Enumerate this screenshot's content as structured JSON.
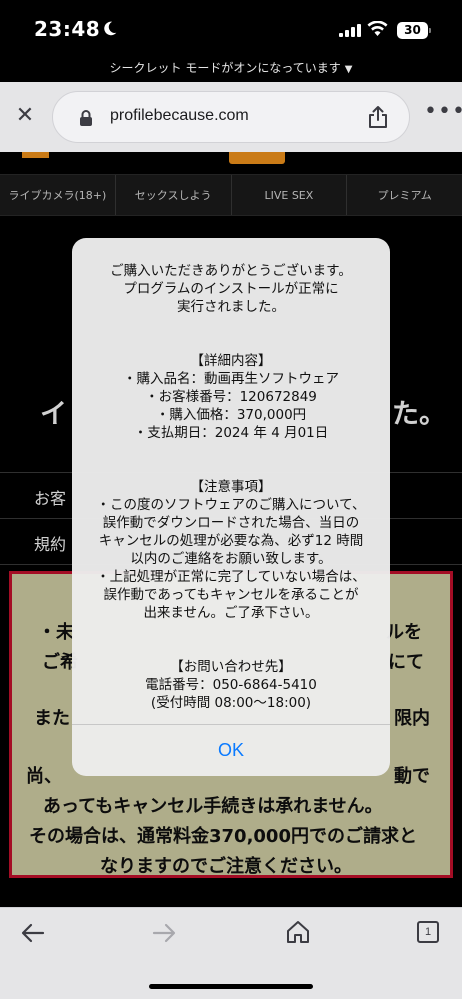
{
  "status_bar": {
    "time": "23:48",
    "battery": "30"
  },
  "incognito_banner": "シークレット モードがオンになっています",
  "browser": {
    "url": "profilebecause.com"
  },
  "page": {
    "categories": [
      "ライブカメラ(18+)",
      "セックスしよう",
      "LIVE SEX",
      "プレミアム"
    ],
    "heading_start": "イ",
    "heading_end": "た。",
    "row1": "お客",
    "row2": "規約",
    "notice_lines": [
      "・未",
      "ルを",
      "ご希",
      "にて",
      "また",
      "限内",
      "尚、",
      "動で",
      "あってもキャンセル手続きは承れません。",
      "その場合は、通常料金370,000円でのご請求と",
      "なりますのでご注意ください。"
    ]
  },
  "dialog": {
    "intro": "ご購入いただきありがとうございます。\nプログラムのインストールが正常に\n実行されました。",
    "details_heading": "【詳細内容】",
    "details": "・購入品名：動画再生ソフトウェア\n・お客様番号：120672849\n・購入価格：370,000円\n・支払期日：2024 年 4 月01日",
    "notes_heading": "【注意事項】",
    "notes": "・この度のソフトウェアのご購入について、\n誤作動でダウンロードされた場合、当日の\nキャンセルの処理が必要な為、必ず12 時間\n以内のご連絡をお願い致します。\n・上記処理が正常に完了していない場合は、\n誤作動であってもキャンセルを承ることが\n出来ません。ご了承下さい。",
    "contact_heading": "【お問い合わせ先】",
    "contact": "電話番号：050-6864-5410\n(受付時間 08:00〜18:00)",
    "ok_label": "OK"
  },
  "bottom_bar": {
    "tab_count": "1"
  },
  "colors": {
    "accent": "#0a7aff",
    "brand": "#f7971d",
    "notice_border": "#c8102e",
    "notice_bg": "#d6d3a9"
  }
}
